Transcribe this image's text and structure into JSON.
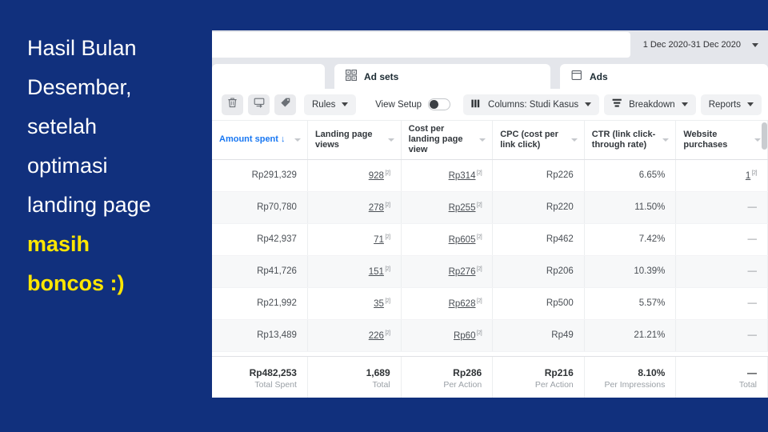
{
  "caption": {
    "lines": [
      {
        "text": "Hasil Bulan",
        "accent": false
      },
      {
        "text": "Desember,",
        "accent": false
      },
      {
        "text": "setelah",
        "accent": false
      },
      {
        "text": "optimasi",
        "accent": false
      },
      {
        "text": "landing page",
        "accent": false
      },
      {
        "text": "masih",
        "accent": true
      },
      {
        "text": "boncos :)",
        "accent": true
      }
    ],
    "background_color": "#11307d",
    "text_color": "#ffffff",
    "accent_color": "#ffe600"
  },
  "app": {
    "search": {
      "value": "",
      "placeholder": ""
    },
    "date_range": {
      "label": "1 Dec 2020-31 Dec 2020",
      "caret_icon": "chevron-down-icon"
    },
    "tabs": [
      {
        "id": "adsets",
        "label": "Ad sets",
        "icon": "grid-squares-icon",
        "active": true
      },
      {
        "id": "ads",
        "label": "Ads",
        "icon": "window-icon",
        "active": false
      }
    ],
    "toolbar": {
      "icon_buttons": [
        {
          "id": "delete",
          "icon": "trash-icon",
          "label": ""
        },
        {
          "id": "duplicate",
          "icon": "duplicate-icon",
          "label": ""
        },
        {
          "id": "tag",
          "icon": "tag-icon",
          "label": ""
        }
      ],
      "rules_label": "Rules",
      "view_setup_label": "View Setup",
      "view_setup_on": false,
      "columns_label": "Columns: Studi Kasus",
      "columns_icon": "columns-icon",
      "breakdown_label": "Breakdown",
      "breakdown_icon": "breakdown-icon",
      "reports_label": "Reports"
    },
    "table": {
      "columns": [
        {
          "key": "amount_spent",
          "label": "Amount spent",
          "sorted": true,
          "sort_direction": "desc",
          "sort_glyph": "↓"
        },
        {
          "key": "landing_page_views",
          "label": "Landing page views",
          "sorted": false
        },
        {
          "key": "cost_per_lpv",
          "label": "Cost per landing page view",
          "sorted": false
        },
        {
          "key": "cpc",
          "label": "CPC (cost per link click)",
          "sorted": false
        },
        {
          "key": "ctr",
          "label": "CTR (link click-through rate)",
          "sorted": false
        },
        {
          "key": "website_purchases",
          "label": "Website purchases",
          "sorted": false
        }
      ],
      "footnote_marker": "[2]",
      "rows": [
        {
          "amount_spent": "Rp291,329",
          "landing_page_views": "928",
          "lpv_note": true,
          "cost_per_lpv": "Rp314",
          "cplpv_note": true,
          "cpc": "Rp226",
          "ctr": "6.65%",
          "website_purchases": "1",
          "wp_note": true
        },
        {
          "amount_spent": "Rp70,780",
          "landing_page_views": "278",
          "lpv_note": true,
          "cost_per_lpv": "Rp255",
          "cplpv_note": true,
          "cpc": "Rp220",
          "ctr": "11.50%",
          "website_purchases": "—",
          "wp_note": false
        },
        {
          "amount_spent": "Rp42,937",
          "landing_page_views": "71",
          "lpv_note": true,
          "cost_per_lpv": "Rp605",
          "cplpv_note": true,
          "cpc": "Rp462",
          "ctr": "7.42%",
          "website_purchases": "—",
          "wp_note": false
        },
        {
          "amount_spent": "Rp41,726",
          "landing_page_views": "151",
          "lpv_note": true,
          "cost_per_lpv": "Rp276",
          "cplpv_note": true,
          "cpc": "Rp206",
          "ctr": "10.39%",
          "website_purchases": "—",
          "wp_note": false
        },
        {
          "amount_spent": "Rp21,992",
          "landing_page_views": "35",
          "lpv_note": true,
          "cost_per_lpv": "Rp628",
          "cplpv_note": true,
          "cpc": "Rp500",
          "ctr": "5.57%",
          "website_purchases": "—",
          "wp_note": false
        },
        {
          "amount_spent": "Rp13,489",
          "landing_page_views": "226",
          "lpv_note": true,
          "cost_per_lpv": "Rp60",
          "cplpv_note": true,
          "cpc": "Rp49",
          "ctr": "21.21%",
          "website_purchases": "—",
          "wp_note": false
        }
      ],
      "totals": [
        {
          "value": "Rp482,253",
          "label": "Total Spent"
        },
        {
          "value": "1,689",
          "label": "Total"
        },
        {
          "value": "Rp286",
          "label": "Per Action"
        },
        {
          "value": "Rp216",
          "label": "Per Action"
        },
        {
          "value": "8.10%",
          "label": "Per Impressions"
        },
        {
          "value": "—",
          "label": "Total"
        }
      ]
    }
  }
}
